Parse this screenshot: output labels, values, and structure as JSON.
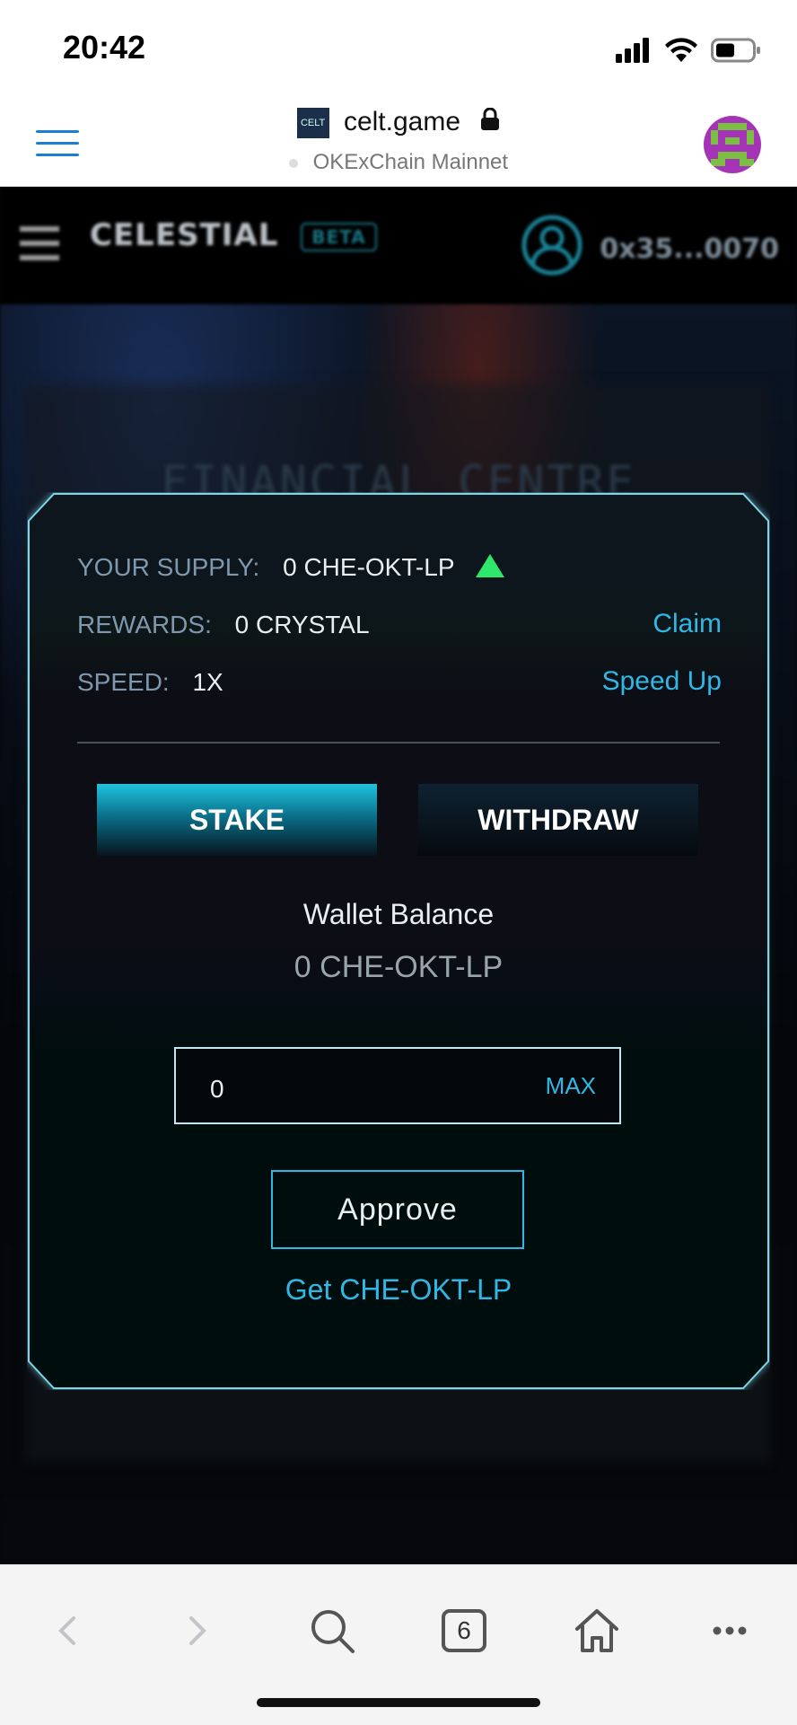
{
  "status_bar": {
    "time": "20:42"
  },
  "browser": {
    "site_title": "celt.game",
    "favicon_text": "CELT",
    "network": "OKExChain Mainnet"
  },
  "game_nav": {
    "logo": "CELESTIAL",
    "beta": "BETA",
    "account": "0x35...0070"
  },
  "page_heading": "FINANCIAL CENTRE",
  "modal": {
    "supply_label": "YOUR SUPPLY:",
    "supply_value": "0 CHE-OKT-LP",
    "rewards_label": "REWARDS:",
    "rewards_value": "0 CRYSTAL",
    "claim_label": "Claim",
    "speed_label": "SPEED:",
    "speed_value": "1X",
    "speed_up_label": "Speed Up",
    "tabs": [
      {
        "label": "STAKE",
        "active": true
      },
      {
        "label": "WITHDRAW",
        "active": false
      }
    ],
    "wallet_balance_label": "Wallet Balance",
    "wallet_balance_value": "0 CHE-OKT-LP",
    "amount_value": "0",
    "max_label": "MAX",
    "approve_label": "Approve",
    "get_link_label": "Get CHE-OKT-LP"
  },
  "toolbar": {
    "tabs_count": "6",
    "icons": [
      "back-icon",
      "forward-icon",
      "search-icon",
      "tabs-icon",
      "home-icon",
      "more-icon"
    ]
  },
  "colors": {
    "accent": "#2fb8e6",
    "frame": "#7ad6e8",
    "supply_up": "#2ee86b",
    "browser_menu": "#1a7fd4"
  }
}
